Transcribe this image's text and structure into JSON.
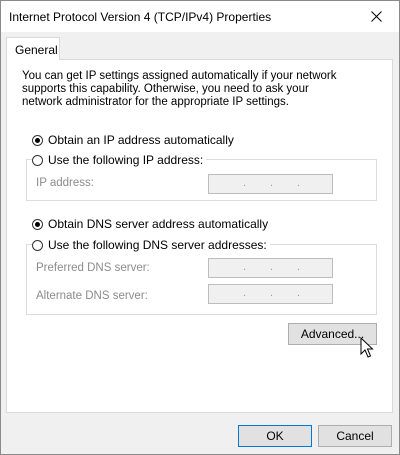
{
  "window": {
    "title": "Internet Protocol Version 4 (TCP/IPv4) Properties",
    "close_icon": "close-icon"
  },
  "tabs": [
    {
      "label": "General",
      "active": true
    }
  ],
  "intro_text": "You can get IP settings assigned automatically if your network supports this capability. Otherwise, you need to ask your network administrator for the appropriate IP settings.",
  "ip_section": {
    "auto_option": {
      "label": "Obtain an IP address automatically",
      "checked": true
    },
    "manual_option": {
      "label": "Use the following IP address:",
      "checked": false
    },
    "fields": [
      {
        "label": "IP address:",
        "value": ".   .   ."
      }
    ]
  },
  "dns_section": {
    "auto_option": {
      "label": "Obtain DNS server address automatically",
      "checked": true
    },
    "manual_option": {
      "label": "Use the following DNS server addresses:",
      "checked": false
    },
    "fields": [
      {
        "label": "Preferred DNS server:",
        "value": ".   .   ."
      },
      {
        "label": "Alternate DNS server:",
        "value": ".   .   ."
      }
    ]
  },
  "buttons": {
    "advanced": "Advanced...",
    "ok": "OK",
    "cancel": "Cancel"
  },
  "colors": {
    "accent": "#0078d7",
    "dialog_bg": "#f0f0f0",
    "panel_bg": "#ffffff",
    "disabled_text": "#8c8c8c"
  }
}
